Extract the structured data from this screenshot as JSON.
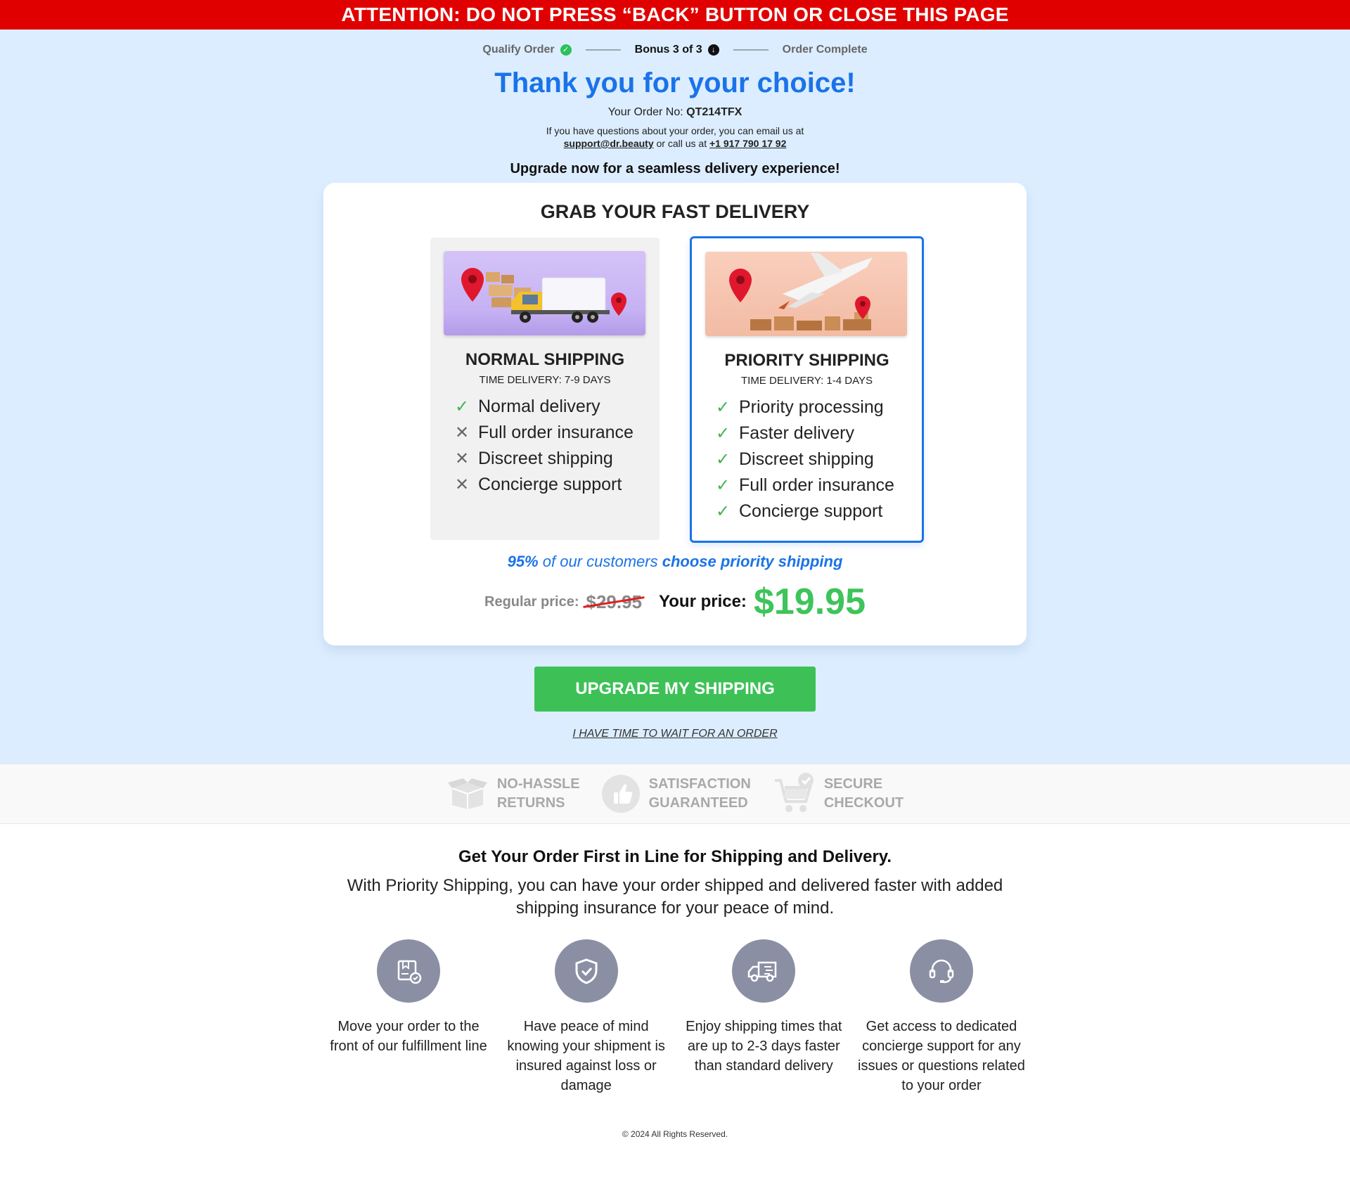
{
  "banner": {
    "text": "ATTENTION: DO NOT PRESS “BACK” BUTTON OR CLOSE THIS PAGE"
  },
  "steps": [
    {
      "label": "Qualify Order",
      "state": "done",
      "icon": "check-circle-icon"
    },
    {
      "label": "Bonus 3 of 3",
      "state": "current",
      "icon": "arrow-down-circle-icon"
    },
    {
      "label": "Order Complete",
      "state": "pending"
    }
  ],
  "header": {
    "title": "Thank you for your choice!",
    "order_label": "Your Order No:",
    "order_number": "QT214TFX",
    "contact_line1": "If you have questions about your order, you can email us at",
    "email": "support@dr.beauty",
    "contact_mid": "or call us at",
    "phone": "+1 917 790 17 92",
    "upgrade_prompt": "Upgrade now for a seamless delivery experience!"
  },
  "card": {
    "title": "GRAB YOUR FAST DELIVERY",
    "normal": {
      "name": "NORMAL SHIPPING",
      "time": "TIME DELIVERY: 7-9 DAYS",
      "features": [
        {
          "label": "Normal delivery",
          "included": true
        },
        {
          "label": "Full order insurance",
          "included": false
        },
        {
          "label": "Discreet shipping",
          "included": false
        },
        {
          "label": "Concierge support",
          "included": false
        }
      ]
    },
    "priority": {
      "name": "PRIORITY SHIPPING",
      "time": "TIME DELIVERY: 1-4 DAYS",
      "features": [
        {
          "label": "Priority processing",
          "included": true
        },
        {
          "label": "Faster delivery",
          "included": true
        },
        {
          "label": "Discreet shipping",
          "included": true
        },
        {
          "label": "Full order insurance",
          "included": true
        },
        {
          "label": "Concierge support",
          "included": true
        }
      ]
    },
    "popular_pct": "95%",
    "popular_mid": "of our customers",
    "popular_end": "choose priority shipping",
    "regular_label": "Regular price:",
    "regular_price": "$29.95",
    "your_label": "Your price:",
    "your_price": "$19.95"
  },
  "cta": {
    "label": "UPGRADE MY SHIPPING",
    "decline": "I HAVE TIME TO WAIT FOR AN ORDER"
  },
  "trust": [
    {
      "line1": "NO-HASSLE",
      "line2": "RETURNS",
      "icon": "box-icon"
    },
    {
      "line1": "SATISFACTION",
      "line2": "GUARANTEED",
      "icon": "thumbs-up-icon"
    },
    {
      "line1": "SECURE",
      "line2": "CHECKOUT",
      "icon": "cart-check-icon"
    }
  ],
  "why": {
    "title": "Get Your Order First in Line for Shipping and Delivery.",
    "text": "With Priority Shipping, you can have your order shipped and delivered faster with added shipping insurance for your peace of mind."
  },
  "benefits": [
    {
      "text": "Move your order to the front of our fulfillment line",
      "icon": "package-check-icon"
    },
    {
      "text": "Have peace of mind knowing your shipment is insured against loss or damage",
      "icon": "shield-check-icon"
    },
    {
      "text": "Enjoy shipping times that are up to 2-3 days faster than standard delivery",
      "icon": "fast-truck-icon"
    },
    {
      "text": "Get access to dedicated concierge support for any issues or questions related to your order",
      "icon": "headset-icon"
    }
  ],
  "footer": {
    "text": "© 2024 All Rights Reserved."
  },
  "colors": {
    "accent_blue": "#1a73e8",
    "cta_green": "#3dc156",
    "banner_red": "#e00000",
    "hero_bg": "#dcedff"
  }
}
